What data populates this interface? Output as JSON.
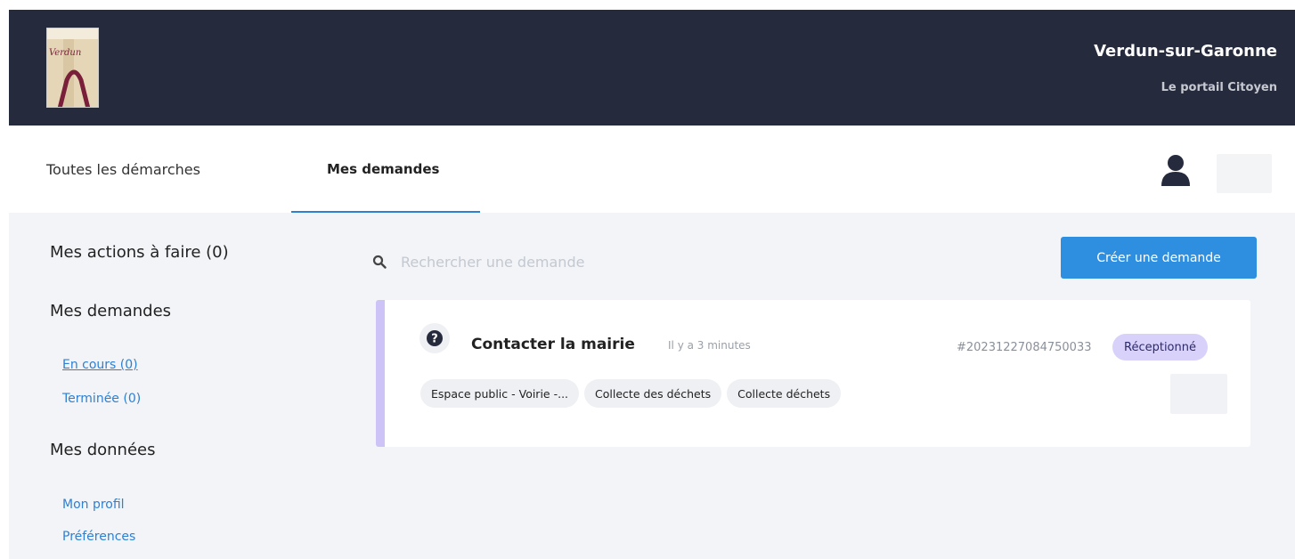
{
  "header": {
    "site_name": "Verdun-sur-Garonne",
    "site_subtitle": "Le portail Citoyen",
    "logo_icon": "verdun-logo",
    "logo_word": "Verdun"
  },
  "nav": {
    "tabs": [
      {
        "label": "Toutes les démarches",
        "active": false
      },
      {
        "label": "Mes demandes",
        "active": true
      }
    ],
    "user_icon": "user-icon"
  },
  "sidebar": {
    "actions_heading": "Mes actions à faire (0)",
    "requests_heading": "Mes demandes",
    "requests_links": [
      {
        "label": "En cours (0)"
      },
      {
        "label": "Terminée (0)"
      }
    ],
    "data_heading": "Mes données",
    "data_links": [
      {
        "label": "Mon profil"
      },
      {
        "label": "Préférences"
      }
    ]
  },
  "search": {
    "placeholder": "Rechercher une demande",
    "value": ""
  },
  "toolbar": {
    "create_label": "Créer une demande"
  },
  "requests": [
    {
      "icon": "question-circle-icon",
      "title": "Contacter la mairie",
      "time": "Il y a 3 minutes",
      "id": "#20231227084750033",
      "status": "Réceptionné",
      "tags": [
        "Espace public - Voirie -...",
        "Collecte des déchets",
        "Collecte déchets"
      ]
    }
  ],
  "colors": {
    "header_bg": "#262a3d",
    "accent": "#2e8fe0",
    "link": "#2f80d1",
    "card_border": "#cdc3f7",
    "status_bg": "#d8d1fa"
  }
}
